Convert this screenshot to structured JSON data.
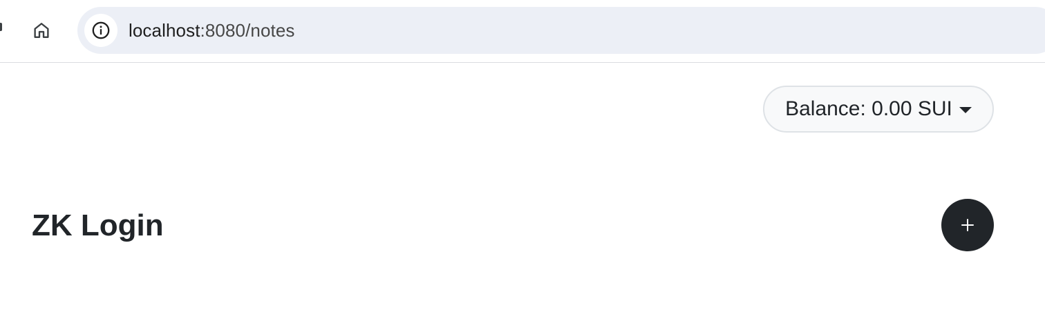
{
  "browser": {
    "url_host": "localhost",
    "url_rest": ":8080/notes",
    "icons": {
      "home": "home-icon",
      "site_info": "info-icon"
    }
  },
  "header": {
    "balance_label": "Balance: 0.00 SUI",
    "balance_caret_icon": "caret-down-icon"
  },
  "main": {
    "title": "ZK Login",
    "add_button_icon": "plus-icon"
  },
  "colors": {
    "omnibox_bg": "#eceff6",
    "dark_button": "#212529",
    "balance_bg": "#f8f9fa",
    "balance_border": "#dee2e6"
  }
}
